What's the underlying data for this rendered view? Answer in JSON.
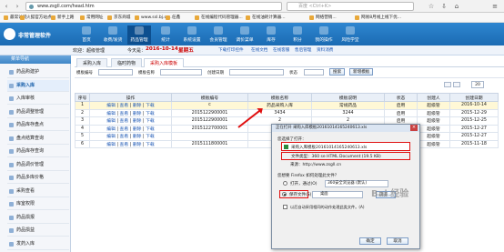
{
  "browser": {
    "url": "www.zsgll.com/head.htm",
    "search_placeholder": "百度 <Ctrl+K>",
    "bookmarks": [
      "最常访问",
      "火狐官方站点",
      "新手上路",
      "常用网址",
      "京东商城",
      "www.ssl.bj.co...",
      "任鑫",
      "在线编程代码管理器...",
      "在线油耗计算器...",
      "网络营销...",
      "网易8月线上线下优..."
    ]
  },
  "app": {
    "title": "非常管理软件",
    "menu": [
      "首页",
      "收费/发货",
      "药品管理",
      "统计",
      "系统设置",
      "会员管理",
      "调价菜单",
      "库存",
      "积分",
      "我的操作",
      "风险学堂"
    ],
    "active_menu_index": 2
  },
  "info_bar": {
    "welcome": "欢迎：超级管理",
    "date_label": "今天是：",
    "date": "2016-10-14",
    "weekday": "星期五",
    "links": [
      "下载打印控件",
      "在线文档",
      "在线客服",
      "售后管理",
      "资料消费"
    ]
  },
  "sidebar": {
    "title": "菜单导航",
    "items": [
      "药品购建护",
      "采购入库",
      "入库审核",
      "药品调整管理",
      "药品库存盘点",
      "盘点结算查询",
      "药品库存查询",
      "药品调价管理",
      "药品多库价格",
      "采购查看",
      "库室权限",
      "药品损报",
      "药品损益",
      "发药入库"
    ],
    "active_index": 1
  },
  "tabs": [
    "采购入库",
    "临时药物",
    "采购入库模板"
  ],
  "active_tab": 2,
  "filter": {
    "fields": [
      "模板编号",
      "模板名称",
      "创建日期",
      "状态"
    ],
    "search_button": "搜索",
    "add_button": "新增模板",
    "page_size": "20"
  },
  "table": {
    "headers": [
      "序号",
      "操作",
      "模板编号",
      "模板名称",
      "模板说明",
      "状态",
      "创建人",
      "创建日期"
    ],
    "op_labels": [
      "编辑",
      "查看",
      "删除",
      "下载"
    ],
    "rows": [
      [
        "1",
        "c",
        "药品采购入库",
        "常规药品",
        "",
        "",
        "2016-10-14"
      ],
      [
        "2",
        "2015122900001",
        "3434",
        "3244",
        "",
        "",
        "2015-12-29"
      ],
      [
        "3",
        "2015122900001",
        "2",
        "2",
        "",
        "",
        "2015-12-25"
      ],
      [
        "4",
        "2015122700001",
        "",
        "",
        "",
        "",
        "2015-12-27"
      ],
      [
        "5",
        "",
        "400QQ",
        "",
        "",
        "",
        "2015-12-27"
      ],
      [
        "6",
        "2015111800001",
        "1",
        "",
        "",
        "",
        "2015-11-18"
      ]
    ],
    "status": "启用",
    "creator": "超级管"
  },
  "dialog": {
    "title": "正在打开 采购入库模板20161014165240613.xls",
    "opening_label": "您选择了打开：",
    "filename": "采购入库模板20161014165240613.xls",
    "type_line": "文件类型：360 se HTML Document (19.5 KB)",
    "source_line": "来源：http://www.zsgll.cn",
    "question": "您想要 Firefox 如何处理此文件？",
    "open_with": "打开，通过(O)",
    "open_with_app": "360安全浏览器 (默认)",
    "save_file": "保存文件(S)",
    "save_location": "桌面",
    "browse": "浏览...",
    "remember": "以后自动采用相同的动作处理此类文件。(A)",
    "ok": "确定",
    "cancel": "取消"
  },
  "watermark": "Bai 经验"
}
